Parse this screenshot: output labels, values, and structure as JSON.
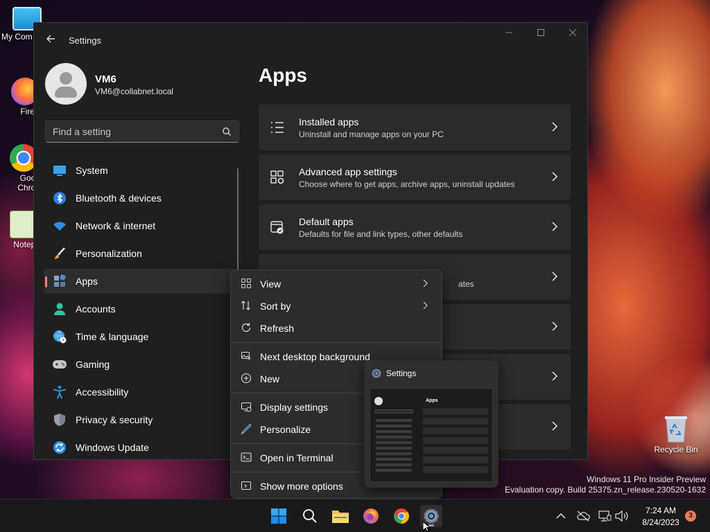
{
  "desktop": {
    "icons": [
      {
        "label": "My Com"
      },
      {
        "label": "Firefo"
      },
      {
        "label": "Goog\nChron"
      },
      {
        "label": "Notepa"
      }
    ],
    "recycle_bin": "Recycle Bin",
    "watermark_line1": "Windows 11 Pro Insider Preview",
    "watermark_line2": "Evaluation copy. Build 25375.zn_release.230520-1632"
  },
  "window": {
    "title": "Settings",
    "profile_name": "VM6",
    "profile_email": "VM6@collabnet.local",
    "search_placeholder": "Find a setting",
    "nav": [
      {
        "label": "System",
        "icon": "monitor-icon"
      },
      {
        "label": "Bluetooth & devices",
        "icon": "bluetooth-icon"
      },
      {
        "label": "Network & internet",
        "icon": "wifi-icon"
      },
      {
        "label": "Personalization",
        "icon": "brush-icon"
      },
      {
        "label": "Apps",
        "icon": "apps-icon",
        "selected": true
      },
      {
        "label": "Accounts",
        "icon": "person-icon"
      },
      {
        "label": "Time & language",
        "icon": "globe-clock-icon"
      },
      {
        "label": "Gaming",
        "icon": "gamepad-icon"
      },
      {
        "label": "Accessibility",
        "icon": "accessibility-icon"
      },
      {
        "label": "Privacy & security",
        "icon": "shield-icon"
      },
      {
        "label": "Windows Update",
        "icon": "update-icon"
      }
    ],
    "page_title": "Apps",
    "cards": [
      {
        "title": "Installed apps",
        "subtitle": "Uninstall and manage apps on your PC"
      },
      {
        "title": "Advanced app settings",
        "subtitle": "Choose where to get apps, archive apps, uninstall updates"
      },
      {
        "title": "Default apps",
        "subtitle": "Defaults for file and link types, other defaults"
      }
    ],
    "partial_texts": {
      "card4_sub": "ates",
      "card6_sub": "er"
    }
  },
  "context_menu": {
    "items": [
      {
        "label": "View",
        "icon": "grid-icon",
        "submenu": true
      },
      {
        "label": "Sort by",
        "icon": "sort-icon",
        "submenu": true
      },
      {
        "label": "Refresh",
        "icon": "refresh-icon"
      },
      {
        "label": "Next desktop background",
        "icon": "image-next-icon"
      },
      {
        "label": "New",
        "icon": "plus-circle-icon"
      },
      {
        "label": "Display settings",
        "icon": "display-icon"
      },
      {
        "label": "Personalize",
        "icon": "pen-icon"
      },
      {
        "label": "Open in Terminal",
        "icon": "terminal-icon"
      },
      {
        "label": "Show more options",
        "icon": "more-options-icon"
      }
    ]
  },
  "preview": {
    "title": "Settings",
    "page_title": "Apps"
  },
  "taskbar": {
    "time": "7:24 AM",
    "date": "8/24/2023",
    "notification_count": "3"
  },
  "colors": {
    "accent": "#f08070",
    "window_bg": "#1f1f1f",
    "card_bg": "#2b2b2b"
  }
}
